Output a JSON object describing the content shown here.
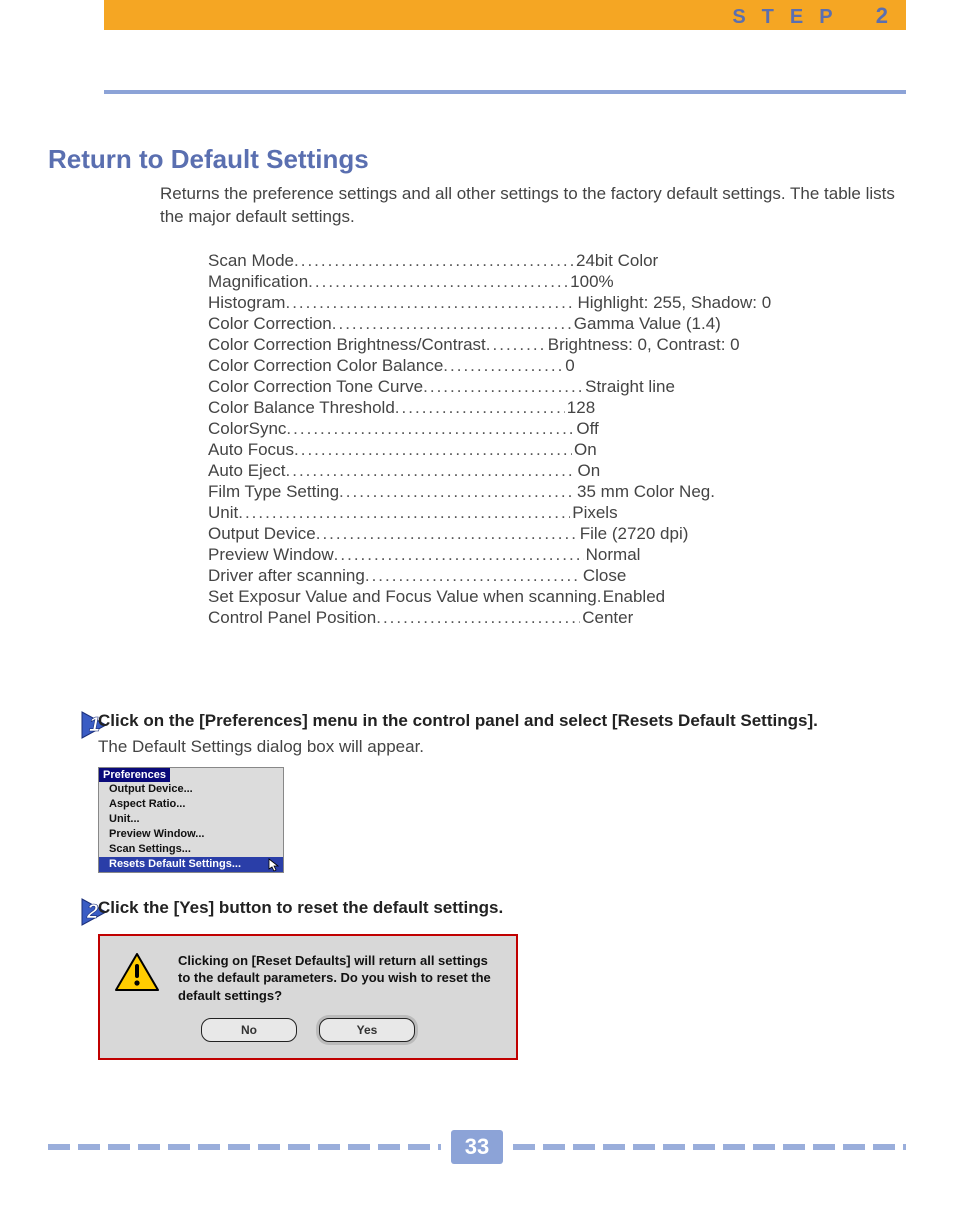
{
  "header": {
    "step_label": "STEP",
    "step_number": "2"
  },
  "section": {
    "title": "Return to Default Settings",
    "intro": "Returns the preference settings and all other settings to the factory default settings. The table lists the major default settings."
  },
  "defaults": [
    {
      "label": "Scan Mode",
      "value": "24bit Color",
      "dw": "dots-w1"
    },
    {
      "label": "Magnification",
      "value": "100%",
      "dw": "dots-w2"
    },
    {
      "label": "Histogram",
      "value": "Highlight: 255, Shadow: 0",
      "dw": "dots-w3"
    },
    {
      "label": "Color Correction",
      "value": "Gamma Value (1.4)",
      "dw": "dots-w4"
    },
    {
      "label": "Color Correction Brightness/Contrast",
      "value": "Brightness: 0, Contrast: 0",
      "dw": "dots-w5"
    },
    {
      "label": "Color Correction Color Balance",
      "value": "0",
      "dw": "dots-w6"
    },
    {
      "label": "Color Correction Tone Curve",
      "value": "Straight line",
      "dw": "dots-w7"
    },
    {
      "label": "Color Balance Threshold",
      "value": "128",
      "dw": "dots-w8"
    },
    {
      "label": "ColorSync",
      "value": "Off",
      "dw": "dots-w9"
    },
    {
      "label": "Auto Focus",
      "value": "On",
      "dw": "dots-wA"
    },
    {
      "label": "Auto Eject",
      "value": "On",
      "dw": "dots-wB"
    },
    {
      "label": "Film Type Setting",
      "value": "35 mm Color Neg.",
      "dw": "dots-wC"
    },
    {
      "label": "Unit",
      "value": "Pixels",
      "dw": "dots-wD"
    },
    {
      "label": "Output Device",
      "value": "File (2720 dpi)",
      "dw": "dots-wE"
    },
    {
      "label": "Preview Window",
      "value": "Normal",
      "dw": "dots-wF"
    },
    {
      "label": "Driver after scanning",
      "value": "Close",
      "dw": "dots-wG"
    },
    {
      "label": "Set Exposur Value and Focus Value when scanning",
      "value": "Enabled",
      "dw": "dots-wH"
    },
    {
      "label": "Control Panel Position",
      "value": "Center",
      "dw": "dots-wI"
    }
  ],
  "steps": {
    "1": {
      "headline": "Click on the [Preferences] menu in the control panel and select [Resets Default Settings].",
      "sub": "The Default Settings dialog box will appear."
    },
    "2": {
      "headline": "Click the [Yes] button to reset the default settings."
    }
  },
  "menu": {
    "title": "Preferences",
    "items": [
      "Output Device...",
      "Aspect Ratio...",
      "Unit...",
      "Preview Window...",
      "Scan Settings..."
    ],
    "highlighted": "Resets Default Settings..."
  },
  "dialog": {
    "text": "Clicking on [Reset Defaults] will return all settings to the default parameters. Do you wish to reset the default settings?",
    "no": "No",
    "yes": "Yes"
  },
  "page_number": "33"
}
